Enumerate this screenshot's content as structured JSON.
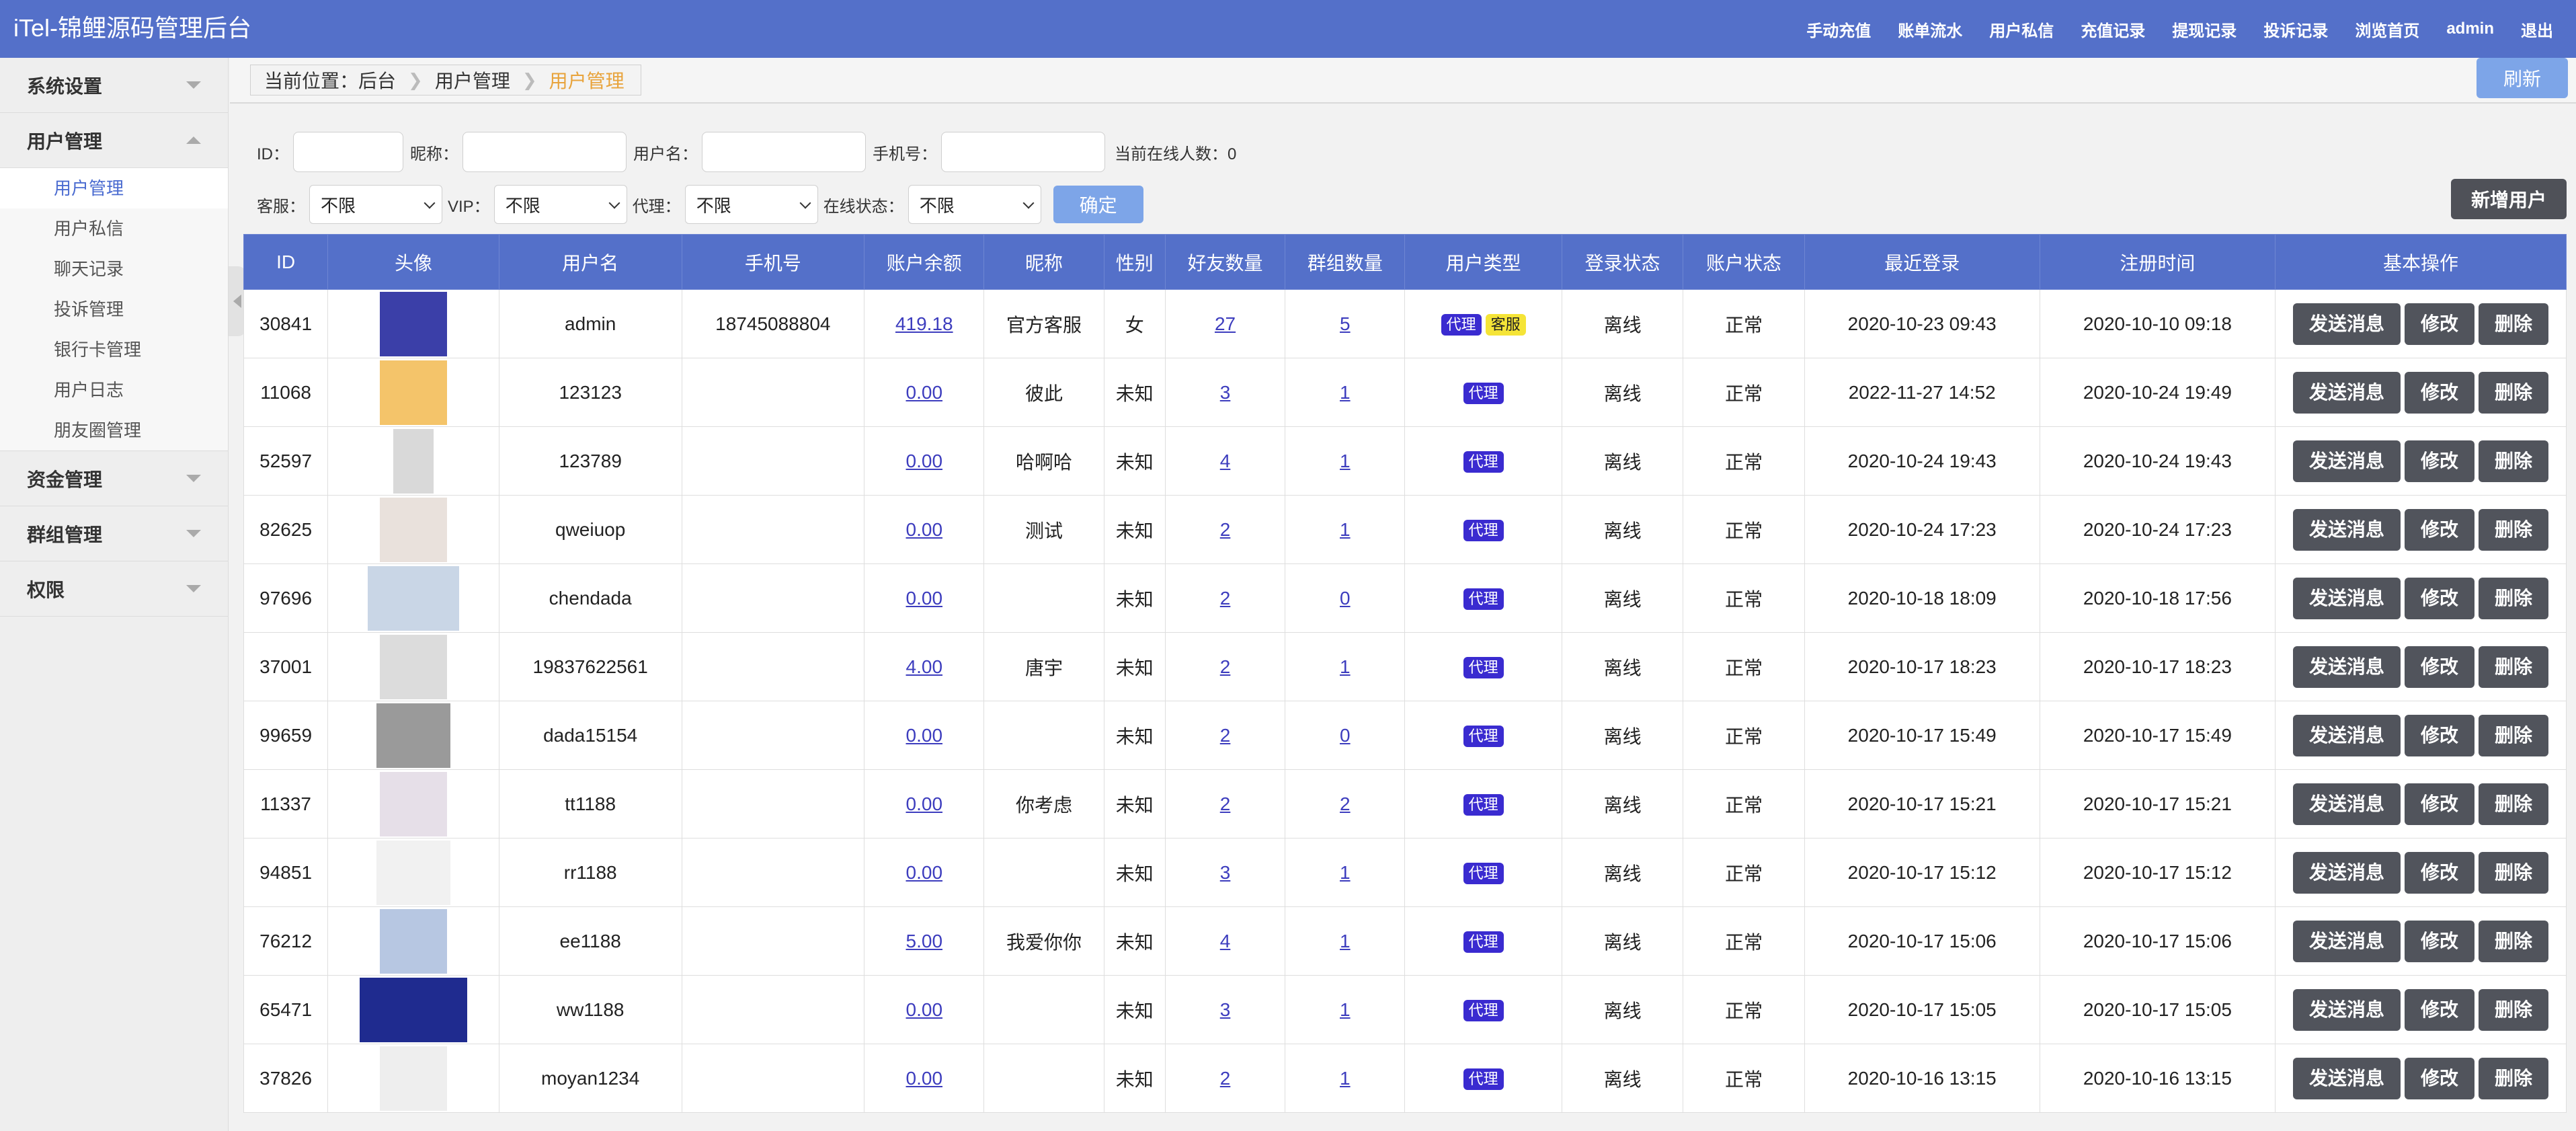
{
  "app": {
    "title": "iTel-锦鲤源码管理后台",
    "topnav": [
      "手动充值",
      "账单流水",
      "用户私信",
      "充值记录",
      "提现记录",
      "投诉记录",
      "浏览首页",
      "admin",
      "退出"
    ]
  },
  "sidebar": {
    "groups": [
      {
        "label": "系统设置"
      },
      {
        "label": "用户管理"
      },
      {
        "label": "资金管理"
      },
      {
        "label": "群组管理"
      },
      {
        "label": "权限"
      }
    ],
    "user_items": [
      "用户管理",
      "用户私信",
      "聊天记录",
      "投诉管理",
      "银行卡管理",
      "用户日志",
      "朋友圈管理"
    ]
  },
  "breadcrumb": {
    "label": "当前位置：后台",
    "level2": "用户管理",
    "current": "用户管理"
  },
  "refresh_label": "刷新",
  "filters": {
    "id_label": "ID：",
    "nickname_label": "昵称：",
    "username_label": "用户名：",
    "phone_label": "手机号：",
    "online_label": "当前在线人数：0",
    "service_label": "客服：",
    "vip_label": "VIP：",
    "agent_label": "代理：",
    "online_status_label": "在线状态：",
    "service_value": "不限",
    "vip_value": "不限",
    "agent_value": "不限",
    "online_status_value": "不限",
    "confirm_label": "确定"
  },
  "add_user_label": "新增用户",
  "table": {
    "headers": [
      "ID",
      "头像",
      "用户名",
      "手机号",
      "账户余额",
      "昵称",
      "性别",
      "好友数量",
      "群组数量",
      "用户类型",
      "登录状态",
      "账户状态",
      "最近登录",
      "注册时间",
      "基本操作"
    ],
    "ops": {
      "send": "发送消息",
      "edit": "修改",
      "delete": "删除"
    },
    "badges": {
      "agent": "代理",
      "service": "客服"
    },
    "rows": [
      {
        "id": "30841",
        "username": "admin",
        "phone": "18745088804",
        "balance": "419.18",
        "nickname": "官方客服",
        "gender": "女",
        "friends": "27",
        "groups": "5",
        "login": "离线",
        "status": "正常",
        "last_login": "2020-10-23 09:43",
        "reg_time": "2020-10-10 09:18"
      },
      {
        "id": "11068",
        "username": "123123",
        "phone": "",
        "balance": "0.00",
        "nickname": "彼此",
        "gender": "未知",
        "friends": "3",
        "groups": "1",
        "login": "离线",
        "status": "正常",
        "last_login": "2022-11-27 14:52",
        "reg_time": "2020-10-24 19:49"
      },
      {
        "id": "52597",
        "username": "123789",
        "phone": "",
        "balance": "0.00",
        "nickname": "哈啊哈",
        "gender": "未知",
        "friends": "4",
        "groups": "1",
        "login": "离线",
        "status": "正常",
        "last_login": "2020-10-24 19:43",
        "reg_time": "2020-10-24 19:43"
      },
      {
        "id": "82625",
        "username": "qweiuop",
        "phone": "",
        "balance": "0.00",
        "nickname": "测试",
        "gender": "未知",
        "friends": "2",
        "groups": "1",
        "login": "离线",
        "status": "正常",
        "last_login": "2020-10-24 17:23",
        "reg_time": "2020-10-24 17:23"
      },
      {
        "id": "97696",
        "username": "chendada",
        "phone": "",
        "balance": "0.00",
        "nickname": "",
        "gender": "未知",
        "friends": "2",
        "groups": "0",
        "login": "离线",
        "status": "正常",
        "last_login": "2020-10-18 18:09",
        "reg_time": "2020-10-18 17:56"
      },
      {
        "id": "37001",
        "username": "19837622561",
        "phone": "",
        "balance": "4.00",
        "nickname": "唐宇",
        "gender": "未知",
        "friends": "2",
        "groups": "1",
        "login": "离线",
        "status": "正常",
        "last_login": "2020-10-17 18:23",
        "reg_time": "2020-10-17 18:23"
      },
      {
        "id": "99659",
        "username": "dada15154",
        "phone": "",
        "balance": "0.00",
        "nickname": "",
        "gender": "未知",
        "friends": "2",
        "groups": "0",
        "login": "离线",
        "status": "正常",
        "last_login": "2020-10-17 15:49",
        "reg_time": "2020-10-17 15:49"
      },
      {
        "id": "11337",
        "username": "tt1188",
        "phone": "",
        "balance": "0.00",
        "nickname": "你考虑",
        "gender": "未知",
        "friends": "2",
        "groups": "2",
        "login": "离线",
        "status": "正常",
        "last_login": "2020-10-17 15:21",
        "reg_time": "2020-10-17 15:21"
      },
      {
        "id": "94851",
        "username": "rr1188",
        "phone": "",
        "balance": "0.00",
        "nickname": "",
        "gender": "未知",
        "friends": "3",
        "groups": "1",
        "login": "离线",
        "status": "正常",
        "last_login": "2020-10-17 15:12",
        "reg_time": "2020-10-17 15:12"
      },
      {
        "id": "76212",
        "username": "ee1188",
        "phone": "",
        "balance": "5.00",
        "nickname": "我爱你你",
        "gender": "未知",
        "friends": "4",
        "groups": "1",
        "login": "离线",
        "status": "正常",
        "last_login": "2020-10-17 15:06",
        "reg_time": "2020-10-17 15:06"
      },
      {
        "id": "65471",
        "username": "ww1188",
        "phone": "",
        "balance": "0.00",
        "nickname": "",
        "gender": "未知",
        "friends": "3",
        "groups": "1",
        "login": "离线",
        "status": "正常",
        "last_login": "2020-10-17 15:05",
        "reg_time": "2020-10-17 15:05"
      },
      {
        "id": "37826",
        "username": "moyan1234",
        "phone": "",
        "balance": "0.00",
        "nickname": "",
        "gender": "未知",
        "friends": "2",
        "groups": "1",
        "login": "离线",
        "status": "正常",
        "last_login": "2020-10-16 13:15",
        "reg_time": "2020-10-16 13:15"
      }
    ]
  },
  "colors": {
    "primary": "#5470c9",
    "button_dark": "#51545c",
    "confirm": "#7da5e8",
    "breadcrumb_current": "#e8a33b",
    "badge_agent": "#3a2bd0",
    "badge_service": "#f5e437"
  }
}
